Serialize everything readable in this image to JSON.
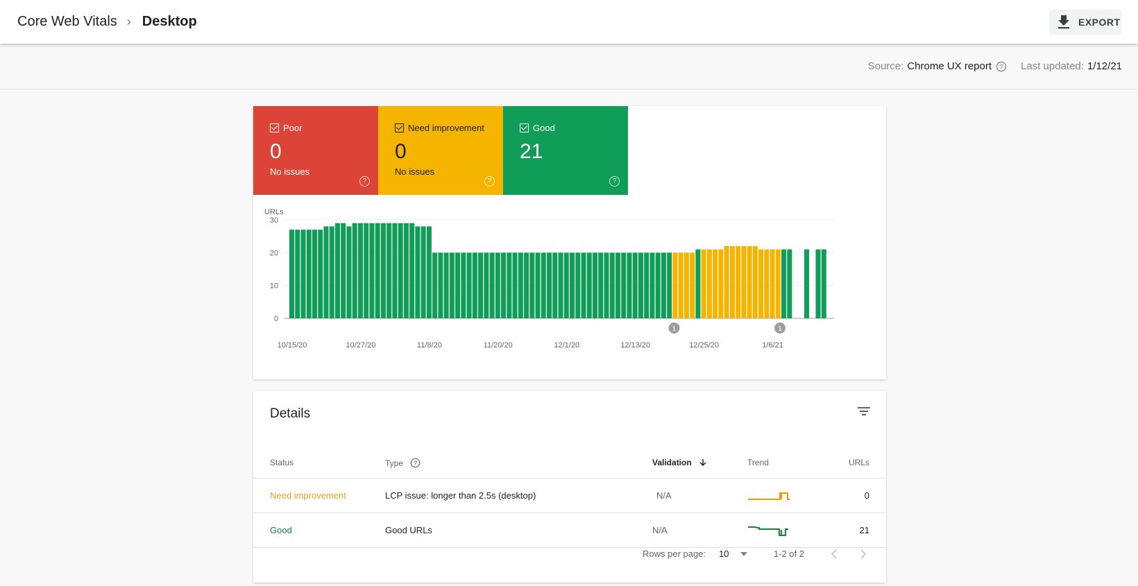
{
  "header": {
    "breadcrumb_parent": "Core Web Vitals",
    "breadcrumb_current": "Desktop",
    "export_label": "EXPORT"
  },
  "subheader": {
    "source_label": "Source:",
    "source_value": "Chrome UX report",
    "updated_label": "Last updated:",
    "updated_value": "1/12/21"
  },
  "summary": {
    "tiles": [
      {
        "label": "Poor",
        "count": "0",
        "sub": "No issues",
        "color": "#db4437",
        "checked": true
      },
      {
        "label": "Need improvement",
        "count": "0",
        "sub": "No issues",
        "color": "#f4b400",
        "checked": true
      },
      {
        "label": "Good",
        "count": "21",
        "sub": "",
        "color": "#0f9d58",
        "checked": true
      }
    ]
  },
  "chart_data": {
    "type": "bar",
    "stacked": true,
    "ylabel": "URLs",
    "ylim": [
      0,
      30
    ],
    "yticks": [
      0,
      10,
      20,
      30
    ],
    "xtick_labels": [
      "10/15/20",
      "10/27/20",
      "11/8/20",
      "11/20/20",
      "12/1/20",
      "12/13/20",
      "12/25/20",
      "1/6/21"
    ],
    "grid": true,
    "start_date": "10/15/20",
    "colors": {
      "good": "#0f9d58",
      "need_improvement": "#f4b400",
      "poor": "#db4437"
    },
    "series": [
      {
        "name": "Good",
        "values": [
          27,
          27,
          27,
          27,
          27,
          27,
          28,
          28,
          29,
          29,
          28,
          29,
          29,
          29,
          29,
          29,
          29,
          29,
          29,
          29,
          29,
          29,
          28,
          28,
          28,
          20,
          20,
          20,
          20,
          20,
          20,
          20,
          20,
          20,
          20,
          20,
          20,
          20,
          20,
          20,
          20,
          20,
          20,
          20,
          20,
          20,
          20,
          20,
          20,
          20,
          20,
          20,
          20,
          20,
          20,
          20,
          20,
          20,
          20,
          20,
          20,
          20,
          20,
          20,
          20,
          20,
          20,
          0,
          0,
          0,
          0,
          21,
          0,
          0,
          0,
          0,
          0,
          0,
          0,
          0,
          0,
          0,
          0,
          0,
          0,
          0,
          21,
          21,
          null,
          null,
          21,
          null,
          21,
          21
        ]
      },
      {
        "name": "Need improvement",
        "values": [
          0,
          0,
          0,
          0,
          0,
          0,
          0,
          0,
          0,
          0,
          0,
          0,
          0,
          0,
          0,
          0,
          0,
          0,
          0,
          0,
          0,
          0,
          0,
          0,
          0,
          0,
          0,
          0,
          0,
          0,
          0,
          0,
          0,
          0,
          0,
          0,
          0,
          0,
          0,
          0,
          0,
          0,
          0,
          0,
          0,
          0,
          0,
          0,
          0,
          0,
          0,
          0,
          0,
          0,
          0,
          0,
          0,
          0,
          0,
          0,
          0,
          0,
          0,
          0,
          0,
          0,
          0,
          20,
          20,
          20,
          20,
          0,
          21,
          21,
          21,
          21,
          22,
          22,
          22,
          22,
          22,
          22,
          21,
          21,
          21,
          21,
          0,
          0,
          null,
          null,
          0,
          null,
          0,
          0
        ]
      },
      {
        "name": "Poor",
        "values": []
      }
    ],
    "annotations": [
      {
        "label": "1",
        "after_date": "12/13/20"
      },
      {
        "label": "1",
        "at_date": "1/6/21"
      }
    ]
  },
  "details": {
    "title": "Details",
    "columns": {
      "status": "Status",
      "type": "Type",
      "validation": "Validation",
      "trend": "Trend",
      "urls": "URLs"
    },
    "rows": [
      {
        "status": "Need improvement",
        "status_color": "#e8a01f",
        "type": "LCP issue: longer than 2.5s (desktop)",
        "validation": "N/A",
        "urls": "0",
        "trend_color": "#f29900"
      },
      {
        "status": "Good",
        "status_color": "#188038",
        "type": "Good URLs",
        "validation": "N/A",
        "urls": "21",
        "trend_color": "#188038"
      }
    ],
    "pagination": {
      "rows_per_page_label": "Rows per page:",
      "rows_per_page_value": "10",
      "range": "1-2 of 2"
    }
  }
}
